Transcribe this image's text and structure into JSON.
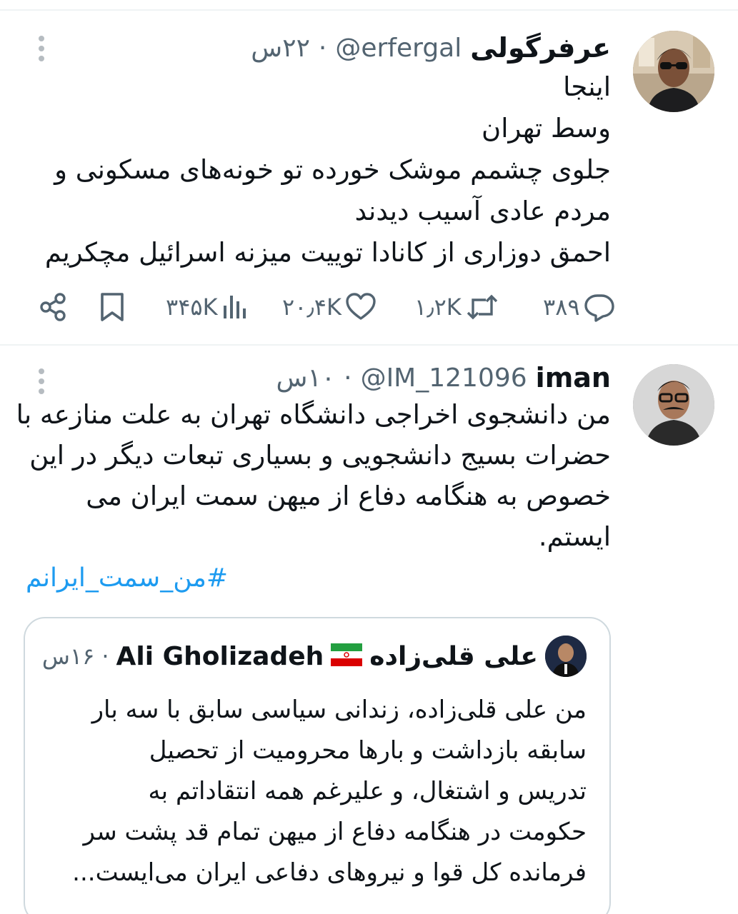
{
  "tweets": [
    {
      "display_name": "عرفرگولی",
      "handle": "@erfergal",
      "separator": "·",
      "time": "۲۲س",
      "body_lines": [
        "اینجا",
        "وسط تهران",
        "جلوی چشمم موشک خورده تو خونه‌های مسکونی و",
        "مردم عادی آسیب دیدند",
        "احمق دوزاری از کانادا توییت میزنه اسرائیل مچکریم"
      ],
      "stats": {
        "replies": "۳۸۹",
        "retweets": "۱٫۲K",
        "likes": "۲۰٫۴K",
        "views": "۳۴۵K"
      }
    },
    {
      "display_name": "iman",
      "handle": "@IM_121096",
      "separator": "·",
      "time": "۱۰س",
      "body_lines": [
        "من دانشجوی اخراجی دانشگاه تهران به علت منازعه با",
        "حضرات بسیج دانشجویی و بسیاری تبعات دیگر در این",
        "خصوص به هنگامه دفاع از میهن سمت ایران می",
        "ایستم."
      ],
      "hashtag": "#من_سمت_ایرانم",
      "quote": {
        "display_name": "علی قلی‌زاده",
        "flag_icon": "iran-flag-icon",
        "handle_name": "Ali Gholizadeh",
        "separator": "·",
        "time": "۱۶س",
        "body_lines": [
          "من علی قلی‌زاده، زندانی سیاسی سابق با سه بار",
          "سابقه بازداشت و بارها محرومیت از تحصیل",
          "تدریس و اشتغال، و علیرغم همه انتقاداتم به",
          "حکومت در هنگامه دفاع از میهن تمام قد پشت سر",
          "فرمانده کل قوا و نیروهای دفاعی ایران می‌ایست..."
        ]
      }
    }
  ],
  "colors": {
    "text": "#0f1419",
    "meta": "#536471",
    "link": "#1d9bf0",
    "border": "#cfd9de",
    "divider": "#eff3f4"
  }
}
